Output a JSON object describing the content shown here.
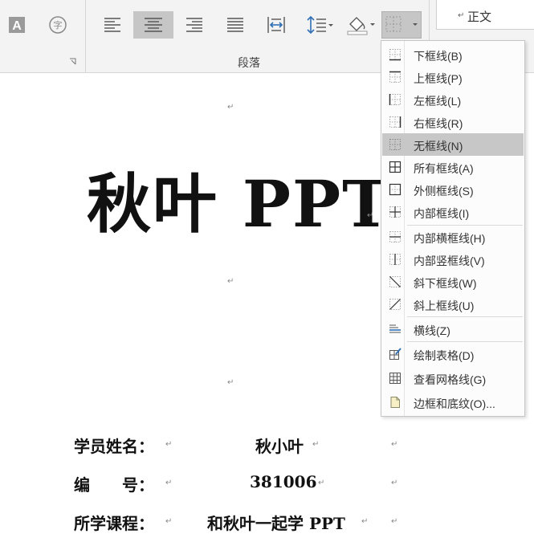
{
  "ribbon": {
    "group_label": "段落",
    "style_name": "正文",
    "colors": {
      "background": "#f3f3f3",
      "active": "#c6c6c6",
      "menu_hover": "#c7c7c7"
    }
  },
  "document": {
    "title": "秋叶 PPT",
    "fields": [
      {
        "label": "学员姓名：",
        "value": "秋小叶"
      },
      {
        "label": "编　　号：",
        "value": "381006"
      },
      {
        "label": "所学课程：",
        "value": "和秋叶一起学 PPT"
      }
    ]
  },
  "borders_menu": {
    "items": [
      {
        "label": "下框线(B)",
        "icon": "border-bottom-icon"
      },
      {
        "label": "上框线(P)",
        "icon": "border-top-icon"
      },
      {
        "label": "左框线(L)",
        "icon": "border-left-icon"
      },
      {
        "label": "右框线(R)",
        "icon": "border-right-icon"
      },
      {
        "label": "无框线(N)",
        "icon": "border-none-icon",
        "highlighted": true
      },
      {
        "label": "所有框线(A)",
        "icon": "border-all-icon"
      },
      {
        "label": "外侧框线(S)",
        "icon": "border-outside-icon"
      },
      {
        "label": "内部框线(I)",
        "icon": "border-inside-icon"
      },
      {
        "label": "内部横框线(H)",
        "icon": "border-inside-horizontal-icon"
      },
      {
        "label": "内部竖框线(V)",
        "icon": "border-inside-vertical-icon"
      },
      {
        "label": "斜下框线(W)",
        "icon": "diagonal-down-border-icon"
      },
      {
        "label": "斜上框线(U)",
        "icon": "diagonal-up-border-icon"
      },
      {
        "label": "横线(Z)",
        "icon": "horizontal-line-icon"
      },
      {
        "label": "绘制表格(D)",
        "icon": "draw-table-icon"
      },
      {
        "label": "查看网格线(G)",
        "icon": "view-gridlines-icon"
      },
      {
        "label": "边框和底纹(O)...",
        "icon": "borders-shading-icon"
      }
    ]
  }
}
